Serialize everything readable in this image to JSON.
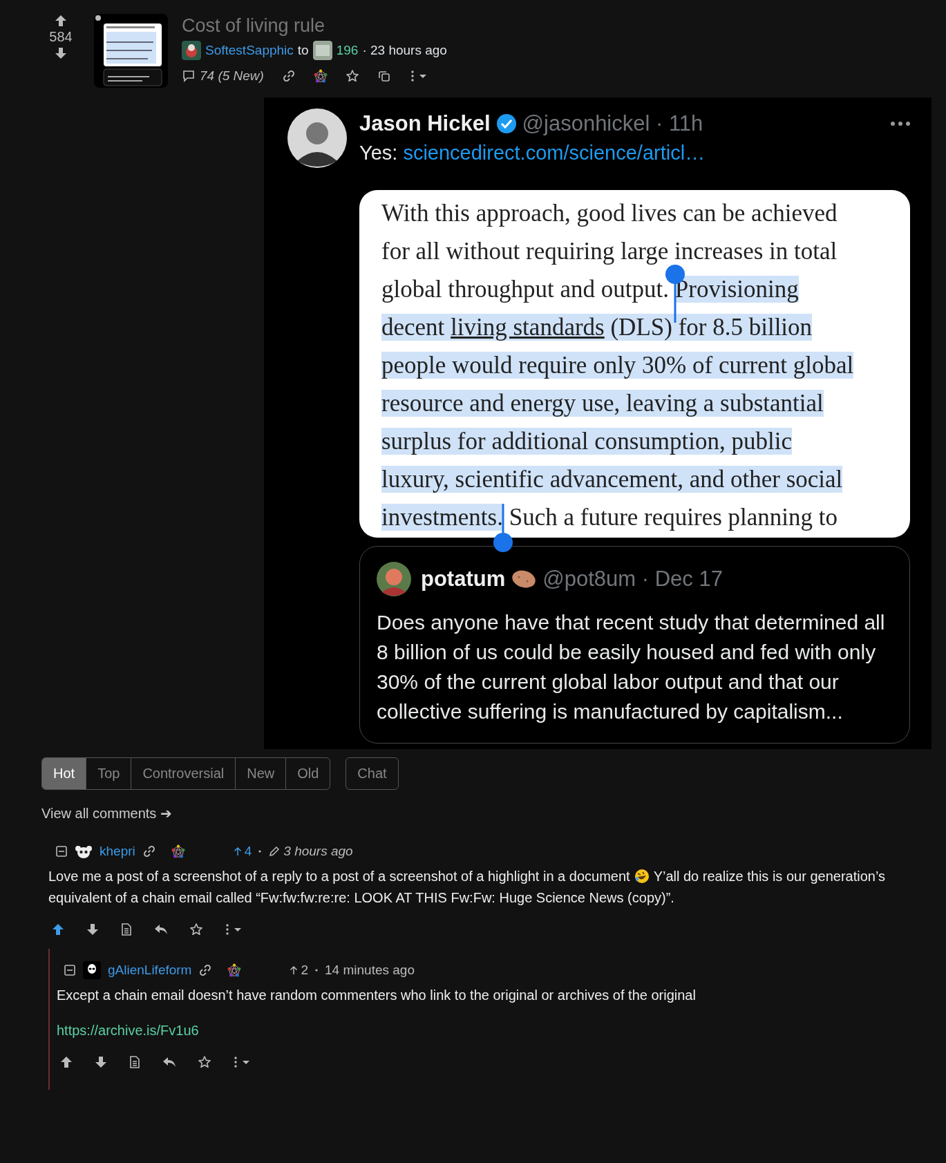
{
  "post": {
    "score": "584",
    "title": "Cost of living rule",
    "author": "SoftestSapphic",
    "to": "to",
    "community": "196",
    "time": "· 23 hours ago",
    "comment_count": "74 (5 New)"
  },
  "tweet": {
    "name": "Jason Hickel",
    "handle": "@jasonhickel · 11h",
    "text": "Yes:",
    "link": "sciencedirect.com/science/articl…",
    "document_lines": [
      [
        {
          "kind": "text",
          "text": "With this approach, good lives can be achieved",
          "highlighted": false,
          "underlined": false
        }
      ],
      [
        {
          "kind": "text",
          "text": "for all without requiring large increases in total",
          "highlighted": false,
          "underlined": false
        }
      ],
      [
        {
          "kind": "text",
          "text": "global throughput and output. ",
          "highlighted": false,
          "underlined": false
        },
        {
          "kind": "start_handle"
        },
        {
          "kind": "text",
          "text": "Provisioning",
          "highlighted": true,
          "underlined": false
        }
      ],
      [
        {
          "kind": "text",
          "text": "decent ",
          "highlighted": true,
          "underlined": false
        },
        {
          "kind": "text",
          "text": "living standards",
          "highlighted": true,
          "underlined": true
        },
        {
          "kind": "text",
          "text": " (DLS) for 8.5 billion",
          "highlighted": true,
          "underlined": false
        }
      ],
      [
        {
          "kind": "text",
          "text": "people would require only 30% of current global",
          "highlighted": true,
          "underlined": false
        }
      ],
      [
        {
          "kind": "text",
          "text": "resource and energy use, leaving a substantial",
          "highlighted": true,
          "underlined": false
        }
      ],
      [
        {
          "kind": "text",
          "text": "surplus for additional consumption, public",
          "highlighted": true,
          "underlined": false
        }
      ],
      [
        {
          "kind": "text",
          "text": "luxury, scientific advancement, and other social",
          "highlighted": true,
          "underlined": false
        }
      ],
      [
        {
          "kind": "text",
          "text": "investments.",
          "highlighted": true,
          "underlined": false
        },
        {
          "kind": "end_handle"
        },
        {
          "kind": "text",
          "text": " Such a future requires planning to",
          "highlighted": false,
          "underlined": false
        }
      ]
    ],
    "quote": {
      "name": "potatum",
      "handle": "@pot8um · Dec 17",
      "text": "Does anyone have that recent study that determined all 8 billion of us could be easily housed and fed with only 30% of the current global labor output and that our collective suffering is manufactured by capitalism..."
    }
  },
  "sort_tabs": [
    {
      "label": "Hot",
      "selected": true
    },
    {
      "label": "Top",
      "selected": false
    },
    {
      "label": "Controversial",
      "selected": false
    },
    {
      "label": "New",
      "selected": false
    },
    {
      "label": "Old",
      "selected": false
    }
  ],
  "chat_button": "Chat",
  "view_all": "View all comments ➔",
  "comments": [
    {
      "author": "khepri",
      "score": "4",
      "upvoted": true,
      "edited": true,
      "time": "3 hours ago",
      "body": [
        [
          {
            "kind": "text",
            "text": "Love me a post of a screenshot of a reply to a post of a screenshot of a highlight in a document"
          },
          {
            "kind": "emoji"
          },
          {
            "kind": "text",
            "text": "Y’all do realize this is our generation’s"
          }
        ],
        [
          {
            "kind": "text",
            "text": "equivalent of a chain email called “Fw:fw:fw:re:re: LOOK AT THIS Fw:Fw: Huge Science News (copy)”."
          }
        ]
      ],
      "children": [
        {
          "author": "gAlienLifeform",
          "score": "2",
          "upvoted": false,
          "edited": false,
          "time": "14 minutes ago",
          "body": [
            [
              {
                "kind": "text",
                "text": "Except a chain email doesn’t have random commenters who link to the original or archives of the original"
              }
            ],
            [
              {
                "kind": "link",
                "text": "https://archive.is/Fv1u6"
              }
            ]
          ]
        }
      ]
    }
  ]
}
